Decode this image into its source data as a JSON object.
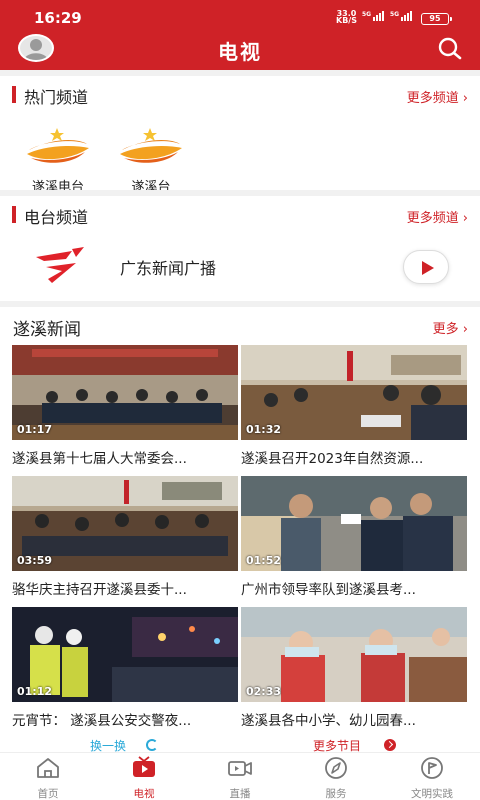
{
  "status_bar": {
    "time": "16:29",
    "net_speed": "33.0",
    "net_unit": "KB/S",
    "sig1": "5G",
    "sig2": "5G",
    "battery": "95"
  },
  "header": {
    "title": "电视"
  },
  "hot_channels": {
    "label": "热门频道",
    "more": "更多频道",
    "items": [
      {
        "name": "遂溪电台"
      },
      {
        "name": "遂溪台"
      }
    ]
  },
  "radio_channels": {
    "label": "电台频道",
    "more": "更多频道",
    "item": {
      "name": "广东新闻广播"
    }
  },
  "news": {
    "label": "遂溪新闻",
    "more": "更多",
    "videos": [
      {
        "duration": "01:17",
        "title": "遂溪县第十七届人大常委会..."
      },
      {
        "duration": "01:32",
        "title": "遂溪县召开2023年自然资源..."
      },
      {
        "duration": "03:59",
        "title": "骆华庆主持召开遂溪县委十..."
      },
      {
        "duration": "01:52",
        "title": "广州市领导率队到遂溪县考..."
      },
      {
        "duration": "01:12",
        "title": "元宵节：  遂溪县公安交警夜..."
      },
      {
        "duration": "02:33",
        "title": "遂溪县各中小学、幼儿园春..."
      }
    ],
    "swap": "换一换",
    "more_programs": "更多节目"
  },
  "tabbar": [
    {
      "label": "首页",
      "icon": "home-icon",
      "active": false
    },
    {
      "label": "电视",
      "icon": "tv-icon",
      "active": true
    },
    {
      "label": "直播",
      "icon": "live-camera-icon",
      "active": false
    },
    {
      "label": "服务",
      "icon": "compass-icon",
      "active": false
    },
    {
      "label": "文明实践",
      "icon": "flag-badge-icon",
      "active": false
    }
  ],
  "colors": {
    "brand": "#cf2227",
    "accent_blue": "#2aa9d8"
  }
}
